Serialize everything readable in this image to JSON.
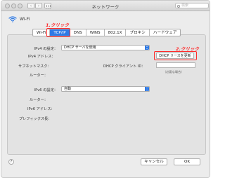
{
  "window": {
    "title": "ネットワーク",
    "search_placeholder": "検索"
  },
  "service": {
    "name": "Wi-Fi"
  },
  "tabs": [
    {
      "label": "Wi-Fi",
      "active": false
    },
    {
      "label": "TCP/IP",
      "active": true
    },
    {
      "label": "DNS",
      "active": false
    },
    {
      "label": "WINS",
      "active": false
    },
    {
      "label": "802.1X",
      "active": false
    },
    {
      "label": "プロキシ",
      "active": false
    },
    {
      "label": "ハードウェア",
      "active": false
    }
  ],
  "annotations": {
    "step1": "1.クリック",
    "step2": "2.クリック",
    "color": "#ff2a2a"
  },
  "ipv4": {
    "config_label": "IPv4 の設定：",
    "config_value": "DHCP サーバを使用",
    "address_label": "IPv4 アドレス：",
    "subnet_label": "サブネットマスク：",
    "router_label": "ルーター：",
    "client_id_label": "DHCP クライアント ID：",
    "client_id_note": "（必要な場合）",
    "renew_button": "DHCP リースを更新"
  },
  "ipv6": {
    "config_label": "IPv6 の設定：",
    "config_value": "自動",
    "router_label": "ルーター：",
    "address_label": "IPv6 アドレス：",
    "prefix_label": "プレフィックス長："
  },
  "footer": {
    "help": "?",
    "cancel": "キャンセル",
    "ok": "OK"
  },
  "colors": {
    "accent": "#2f7ae5"
  }
}
